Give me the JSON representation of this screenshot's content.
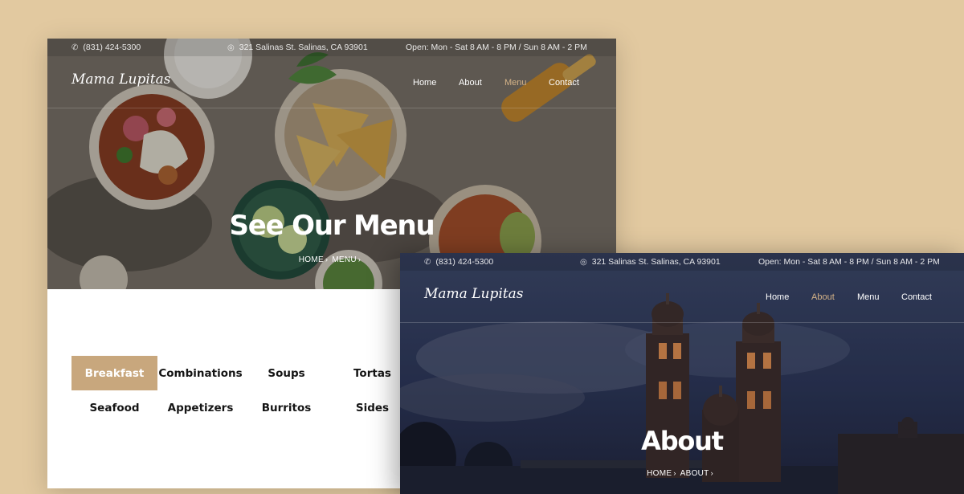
{
  "colors": {
    "page_background": "#e2c9a0",
    "accent": "#c8a77d",
    "active_nav": "#d4b287"
  },
  "menu_page": {
    "topbar": {
      "phone": "(831) 424-5300",
      "address": "321 Salinas St. Salinas, CA 93901",
      "hours": "Open: Mon - Sat 8 AM - 8 PM / Sun 8 AM - 2 PM"
    },
    "logo": "Mama Lupitas",
    "nav": [
      {
        "label": "Home"
      },
      {
        "label": "About"
      },
      {
        "label": "Menu",
        "active": true
      },
      {
        "label": "Contact"
      }
    ],
    "hero_title": "See Our Menu",
    "breadcrumb": [
      "HOME",
      "MENU"
    ],
    "categories": [
      {
        "label": "Breakfast",
        "active": true
      },
      {
        "label": "Combinations"
      },
      {
        "label": "Soups"
      },
      {
        "label": "Tortas"
      },
      {
        "label": "Seafood"
      },
      {
        "label": "Appetizers"
      },
      {
        "label": "Burritos"
      },
      {
        "label": "Sides"
      }
    ]
  },
  "about_page": {
    "topbar": {
      "phone": "(831) 424-5300",
      "address": "321 Salinas St. Salinas, CA 93901",
      "hours": "Open: Mon - Sat 8 AM - 8 PM / Sun 8 AM - 2 PM"
    },
    "logo": "Mama Lupitas",
    "nav": [
      {
        "label": "Home"
      },
      {
        "label": "About",
        "active": true
      },
      {
        "label": "Menu"
      },
      {
        "label": "Contact"
      }
    ],
    "hero_title": "About",
    "breadcrumb": [
      "HOME",
      "ABOUT"
    ]
  }
}
